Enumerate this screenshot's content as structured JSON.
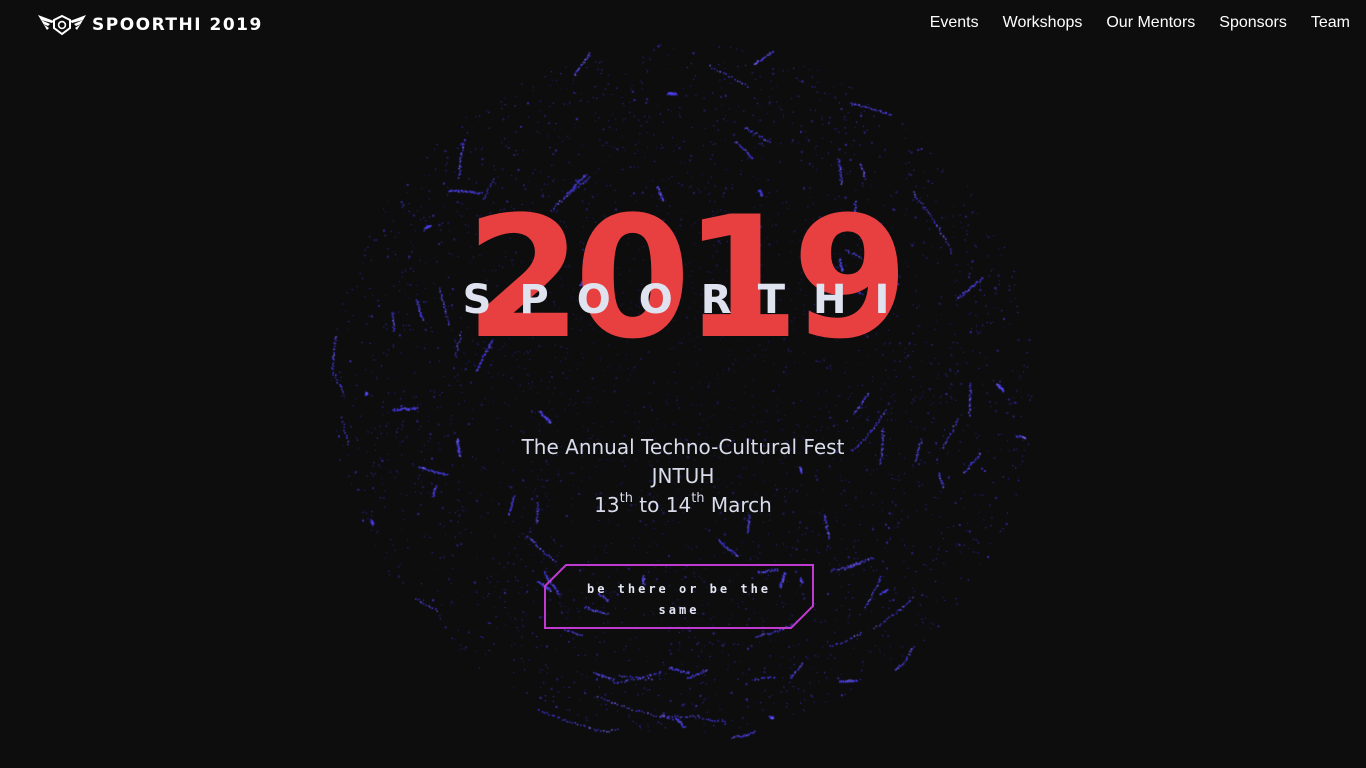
{
  "header": {
    "brand": "SPOORTHI 2019",
    "logo_icon": "winged-shield-logo-icon"
  },
  "nav": {
    "items": [
      {
        "label": "Events"
      },
      {
        "label": "Workshops"
      },
      {
        "label": "Our Mentors"
      },
      {
        "label": "Sponsors"
      },
      {
        "label": "Team"
      }
    ]
  },
  "hero": {
    "year": "2019",
    "name": "SPOORTHI",
    "tagline": {
      "line1": "The Annual Techno-Cultural Fest",
      "line2": "JNTUH",
      "date_start_num": "13",
      "date_start_suffix": "th",
      "date_to": "to",
      "date_end_num": "14",
      "date_end_suffix": "th",
      "date_month": "March"
    },
    "cta": "Be there or be the same"
  },
  "colors": {
    "background": "#0d0d0e",
    "year_red": "#e84040",
    "particles": "#4a3df0",
    "cta_border": "#c03ad0"
  }
}
